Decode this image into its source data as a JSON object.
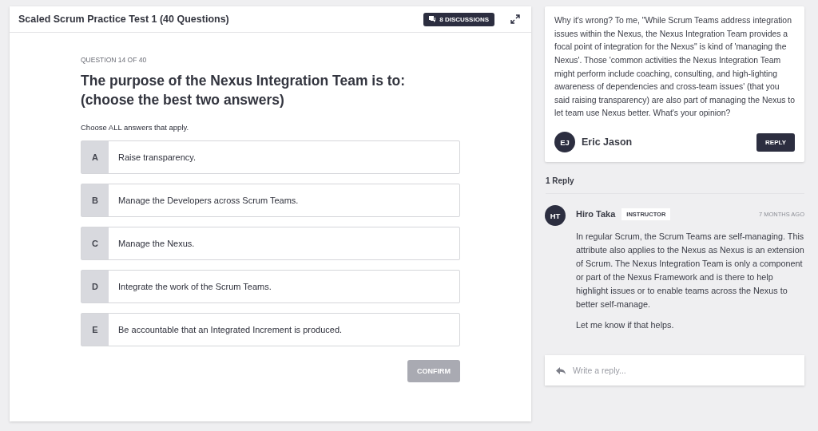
{
  "quiz": {
    "title": "Scaled Scrum Practice Test 1 (40 Questions)",
    "discussions_button": "8 DISCUSSIONS",
    "progress": "QUESTION 14 OF 40",
    "question": "The purpose of the Nexus Integration Team is to:\n(choose the best two answers)",
    "instruction": "Choose ALL answers that apply.",
    "options": [
      {
        "letter": "A",
        "text": "Raise transparency.",
        "selected": false
      },
      {
        "letter": "B",
        "text": "Manage the Developers across Scrum Teams.",
        "selected": false
      },
      {
        "letter": "C",
        "text": "Manage the Nexus.",
        "selected": false
      },
      {
        "letter": "D",
        "text": "Integrate the work of the Scrum Teams.",
        "selected": false
      },
      {
        "letter": "E",
        "text": "Be accountable that an Integrated Increment is produced.",
        "selected": false
      }
    ],
    "confirm": {
      "label": "CONFIRM",
      "disabled": true
    }
  },
  "discussion": {
    "comment": {
      "text": "Why it's wrong? To me, \"While Scrum Teams address integration issues within the Nexus, the Nexus Integration Team provides a focal point of integration for the Nexus\" is kind of 'managing the Nexus'. Those 'common activities the Nexus Integration Team might perform include coaching, consulting, and high-lighting awareness of dependencies and cross-team issues' (that you said raising transparency) are also part of managing the Nexus to let team use Nexus better.  What's your opinion?",
      "initials": "EJ",
      "author": "Eric Jason",
      "reply_button": "REPLY"
    },
    "reply_count": "1 Reply",
    "replies": [
      {
        "initials": "HT",
        "author": "Hiro Taka",
        "badge": "INSTRUCTOR",
        "time": "7 MONTHS AGO",
        "paragraphs": [
          "In regular Scrum, the Scrum Teams are self-managing. This attribute also applies to the Nexus as Nexus is an extension of Scrum. The Nexus Integration Team is only a component or part of the Nexus Framework and is there to help highlight issues or to enable teams across the Nexus to better self-manage.",
          "Let me know if that helps."
        ]
      }
    ],
    "reply_field": {
      "placeholder": "Write a reply..."
    }
  }
}
